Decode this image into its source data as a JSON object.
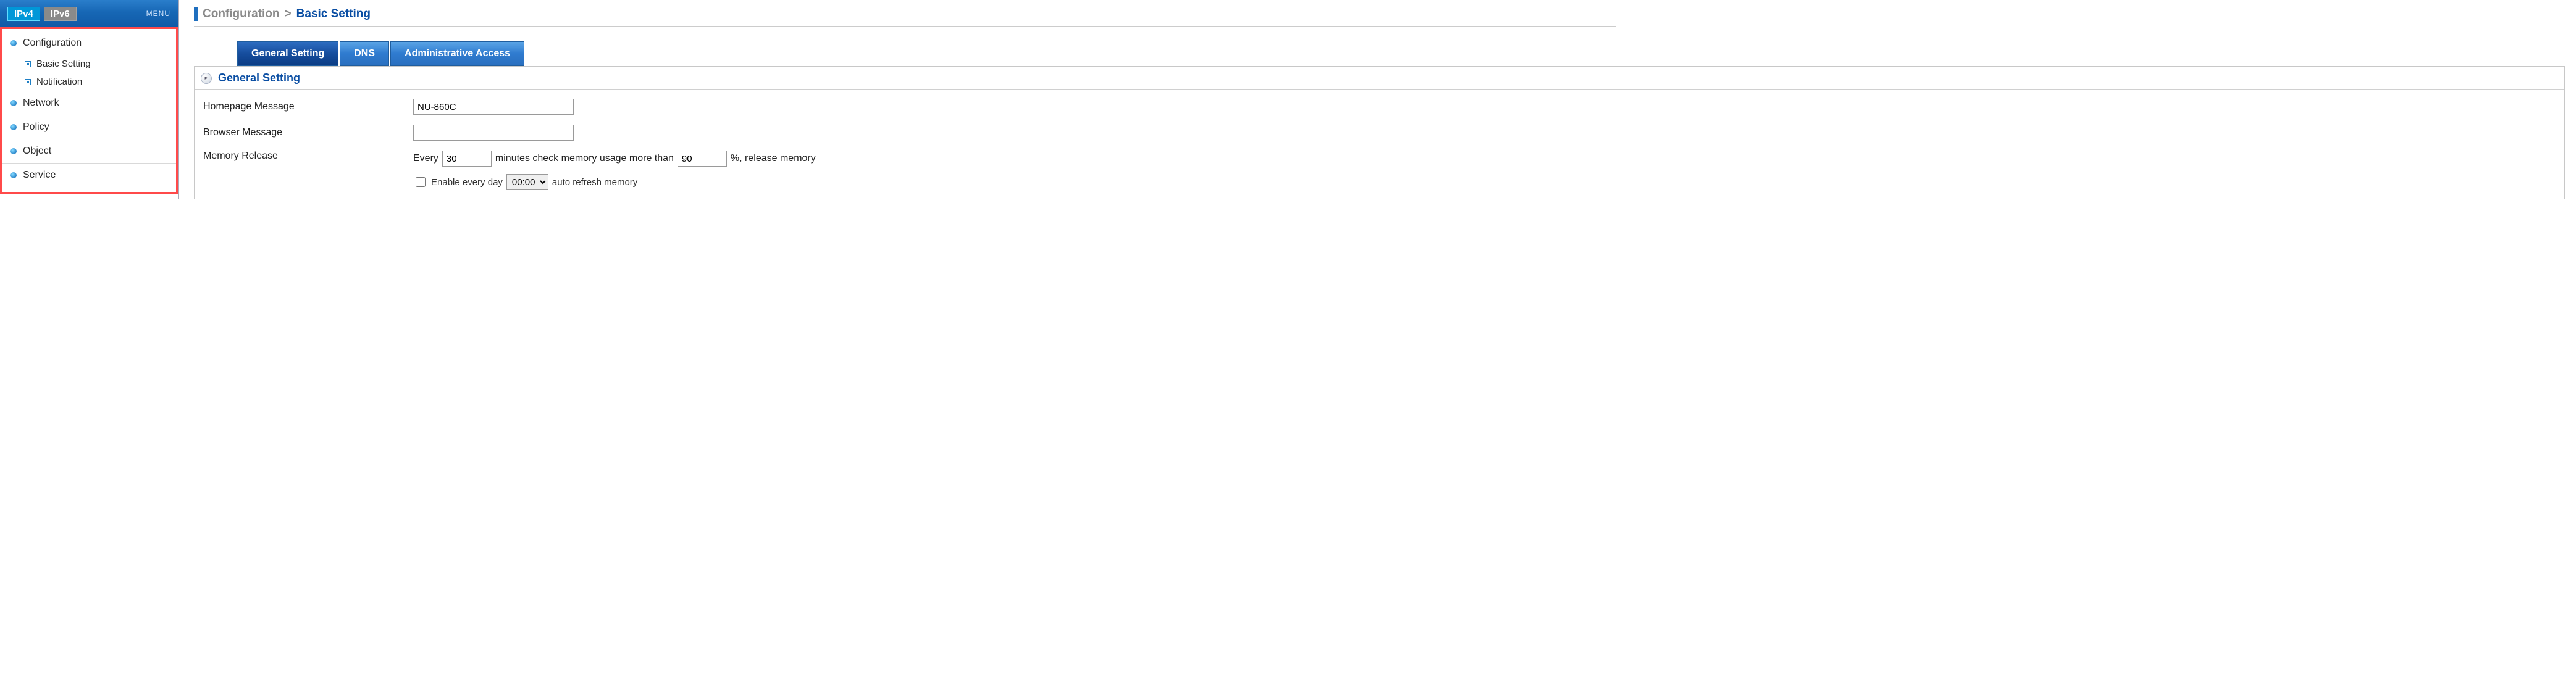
{
  "sidebar": {
    "ipv4_label": "IPv4",
    "ipv6_label": "IPv6",
    "menu_label": "MENU",
    "sections": [
      {
        "label": "Configuration",
        "expanded": true,
        "children": [
          {
            "label": "Basic Setting"
          },
          {
            "label": "Notification"
          }
        ]
      },
      {
        "label": "Network"
      },
      {
        "label": "Policy"
      },
      {
        "label": "Object"
      },
      {
        "label": "Service"
      }
    ]
  },
  "breadcrumb": {
    "parent": "Configuration",
    "separator": ">",
    "current": "Basic Setting"
  },
  "tabs": [
    {
      "label": "General Setting",
      "active": true
    },
    {
      "label": "DNS",
      "active": false
    },
    {
      "label": "Administrative Access",
      "active": false
    }
  ],
  "panel": {
    "title": "General Setting",
    "homepage_label": "Homepage Message",
    "homepage_value": "NU-860C",
    "browser_label": "Browser Message",
    "browser_value": "",
    "memory_label": "Memory Release",
    "mem_every": "Every",
    "mem_minutes_value": "30",
    "mem_mid": "minutes check memory usage more than",
    "mem_percent_value": "90",
    "mem_tail": "%, release memory",
    "enable_refresh_label_pre": "Enable  every day",
    "refresh_time": "00:00",
    "enable_refresh_label_post": "auto refresh memory"
  }
}
